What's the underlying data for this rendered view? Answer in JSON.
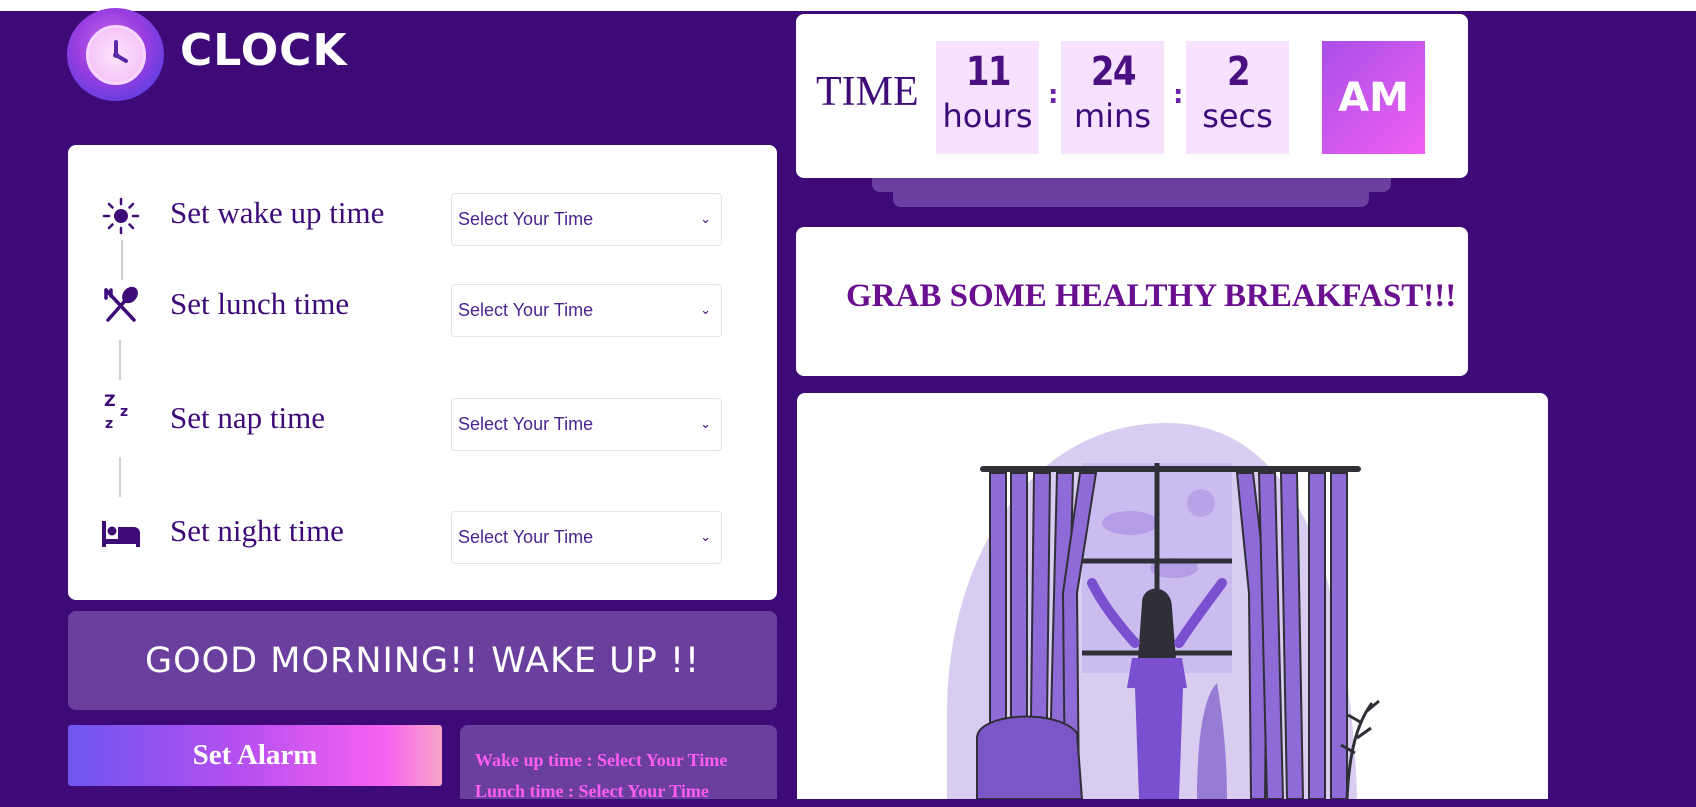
{
  "logo": {
    "text": "CLOCK",
    "icon": "clock-icon"
  },
  "schedule": {
    "rows": [
      {
        "label": "Set wake up time",
        "icon": "sun-icon",
        "value": "Select Your Time"
      },
      {
        "label": "Set lunch time",
        "icon": "utensils-icon",
        "value": "Select Your Time"
      },
      {
        "label": "Set nap time",
        "icon": "sleep-zzz-icon",
        "value": "Select Your Time"
      },
      {
        "label": "Set night time",
        "icon": "bed-icon",
        "value": "Select Your Time"
      }
    ]
  },
  "greeting": "GOOD MORNING!! WAKE UP !!",
  "alarm_button": "Set Alarm",
  "summary": {
    "wake": "Wake up time : Select Your Time",
    "lunch": "Lunch time : Select Your Time"
  },
  "clock": {
    "label": "TIME",
    "hours": "11",
    "hours_unit": "hours",
    "mins": "24",
    "mins_unit": "mins",
    "secs": "2",
    "secs_unit": "secs",
    "separator": ":",
    "ampm": "AM"
  },
  "message": "GRAB SOME HEALTHY BREAKFAST!!!",
  "colors": {
    "background": "#3d0a78",
    "panel": "#6b3f9e",
    "accent_pink": "#f060f0",
    "text_purple": "#3d0a78"
  }
}
